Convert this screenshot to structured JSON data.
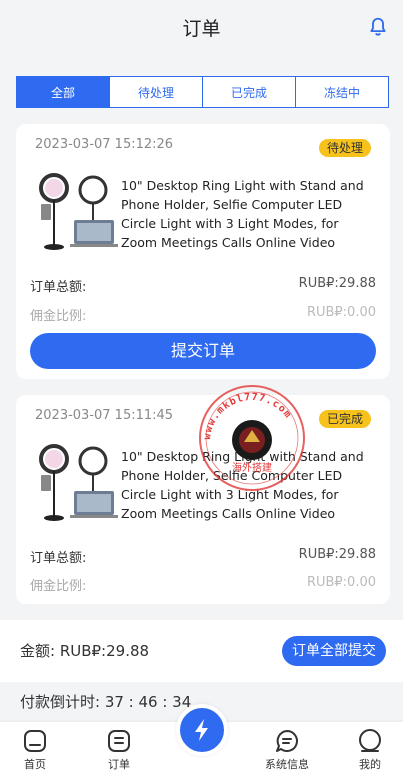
{
  "header": {
    "title": "订单",
    "bell_icon": "bell-icon"
  },
  "tabs": [
    {
      "label": "全部",
      "active": true
    },
    {
      "label": "待处理",
      "active": false
    },
    {
      "label": "已完成",
      "active": false
    },
    {
      "label": "冻结中",
      "active": false
    }
  ],
  "orders": [
    {
      "time": "2023-03-07 15:12:26",
      "status": "待处理",
      "product_name": "10\" Desktop Ring Light with Stand and Phone Holder, Selfie Computer LED Circle Light with 3 Light Modes, for Zoom Meetings Calls Online Video",
      "total_label": "订单总额:",
      "total_value": "RUB₽:29.88",
      "commission_label": "佣金比例:",
      "commission_value": "RUB₽:0.00",
      "button_label": "提交订单"
    },
    {
      "time": "2023-03-07 15:11:45",
      "status": "已完成",
      "product_name": "10\" Desktop Ring Light with Stand and Phone Holder, Selfie Computer LED Circle Light with 3 Light Modes, for Zoom Meetings Calls Online Video",
      "total_label": "订单总额:",
      "total_value": "RUB₽:29.88",
      "commission_label": "佣金比例:",
      "commission_value": "RUB₽:0.00"
    }
  ],
  "watermark": {
    "text": "www.mkbl777.com",
    "subtext": "海外搭建"
  },
  "summary": {
    "amount_text": "金额:  RUB₽:29.88",
    "submit_all_label": "订单全部提交"
  },
  "countdown": {
    "text": "付款倒计时:  37 : 46 : 34"
  },
  "tabbar": {
    "items": [
      {
        "label": "首页",
        "icon": "home-icon"
      },
      {
        "label": "订单",
        "icon": "orders-icon"
      },
      {
        "label": "系统信息",
        "icon": "message-icon"
      },
      {
        "label": "我的",
        "icon": "profile-icon"
      }
    ],
    "center_icon": "lightning-icon"
  },
  "colors": {
    "primary": "#2f6bf0",
    "badge": "#f7c21b",
    "background": "#f3f4f6"
  }
}
